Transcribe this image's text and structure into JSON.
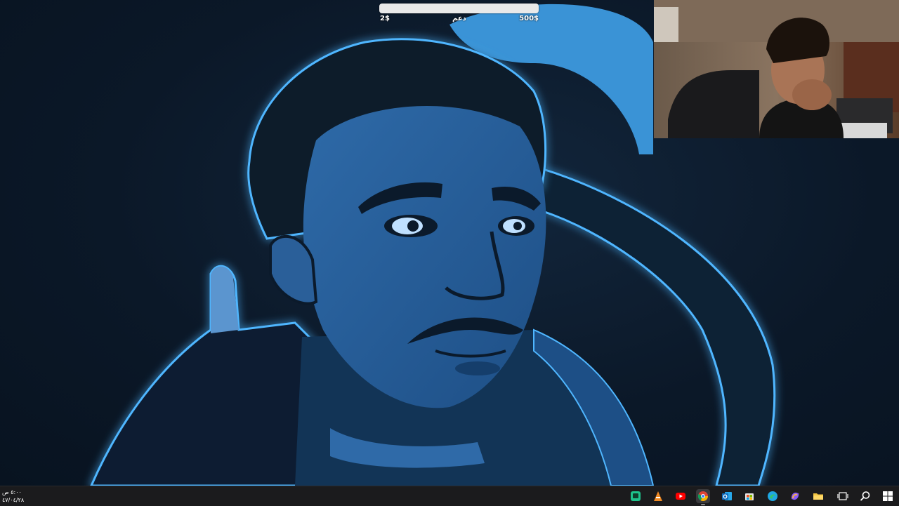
{
  "donation": {
    "min_label": "2$",
    "center_label": "دعم",
    "max_label": "500$",
    "progress": 0.0
  },
  "taskbar": {
    "clock_time": "٥:٠٠ ص",
    "clock_date": "٤٧/٠٤/٢٨",
    "apps": [
      {
        "name": "mobile-app-icon",
        "color": "#1ec28b"
      },
      {
        "name": "vlc-icon",
        "color": "#f08a24"
      },
      {
        "name": "youtube-icon",
        "color": "#ff0000"
      },
      {
        "name": "chrome-icon",
        "color": "#db4437"
      },
      {
        "name": "outlook-icon",
        "color": "#0f6cbd"
      },
      {
        "name": "store-icon",
        "color": "#e6e6e6"
      },
      {
        "name": "edge-icon",
        "color": "#1fa7e2"
      },
      {
        "name": "copilot-icon",
        "color": "#8b5cf6"
      },
      {
        "name": "file-explorer-icon",
        "color": "#f4c542"
      },
      {
        "name": "task-view-icon",
        "color": "#ffffff"
      },
      {
        "name": "search-icon",
        "color": "#ffffff"
      },
      {
        "name": "windows-start-icon",
        "color": "#ffffff"
      }
    ]
  },
  "colors": {
    "wallpaper_bg": "#0b1828",
    "accent_blue": "#2f9be6",
    "glow": "#4fb6ff",
    "taskbar_bg": "#1b1b1d"
  }
}
